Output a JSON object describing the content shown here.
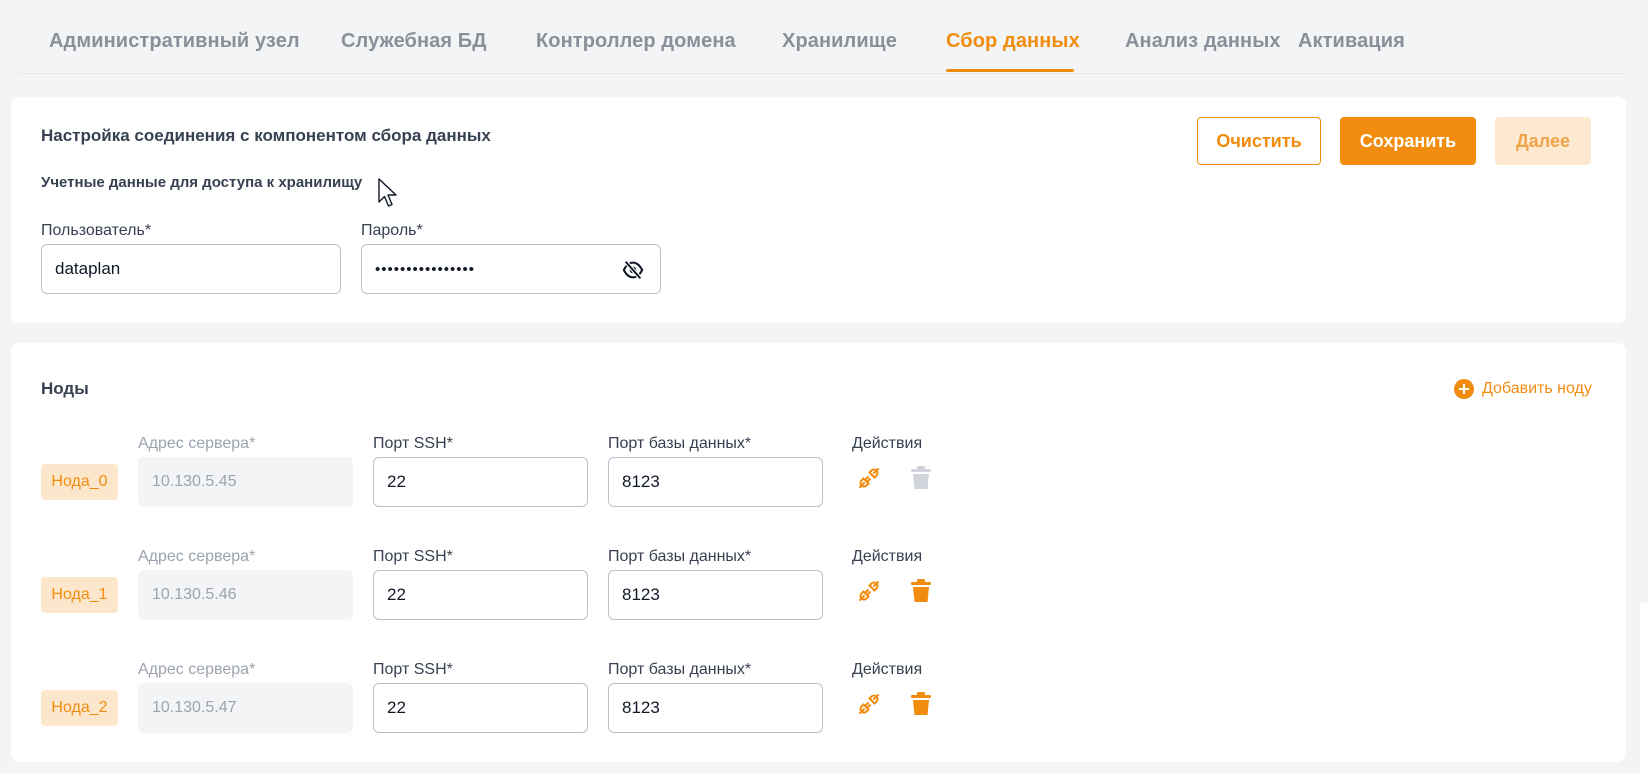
{
  "tabs": [
    {
      "label": "Административный узел"
    },
    {
      "label": "Служебная БД"
    },
    {
      "label": "Контроллер домена"
    },
    {
      "label": "Хранилище"
    },
    {
      "label": "Сбор данных",
      "active": true
    },
    {
      "label": "Анализ данных"
    },
    {
      "label": "Активация"
    }
  ],
  "connection": {
    "title": "Настройка соединения с компонентом сбора данных",
    "subtitle": "Учетные данные для доступа к хранилищу",
    "user_label": "Пользователь*",
    "user_value": "dataplan",
    "password_label": "Пароль*",
    "password_masked": "••••••••••••••••",
    "buttons": {
      "clear": "Очистить",
      "save": "Сохранить",
      "next": "Далее"
    }
  },
  "nodes": {
    "title": "Ноды",
    "add_label": "Добавить ноду",
    "labels": {
      "address": "Адрес сервера*",
      "ssh_port": "Порт SSH*",
      "db_port": "Порт базы данных*",
      "actions": "Действия"
    },
    "items": [
      {
        "name": "Нода_0",
        "address": "10.130.5.45",
        "ssh_port": "22",
        "db_port": "8123",
        "delete_enabled": false
      },
      {
        "name": "Нода_1",
        "address": "10.130.5.46",
        "ssh_port": "22",
        "db_port": "8123",
        "delete_enabled": true
      },
      {
        "name": "Нода_2",
        "address": "10.130.5.47",
        "ssh_port": "22",
        "db_port": "8123",
        "delete_enabled": true
      }
    ]
  },
  "colors": {
    "accent": "#f28c0f",
    "accent_light": "#fde7cc",
    "muted_icon": "#d1d5db"
  },
  "icons": {
    "password_toggle": "eye-off-icon",
    "connect": "plug-icon",
    "delete": "trash-icon",
    "add": "plus-circle-icon"
  }
}
